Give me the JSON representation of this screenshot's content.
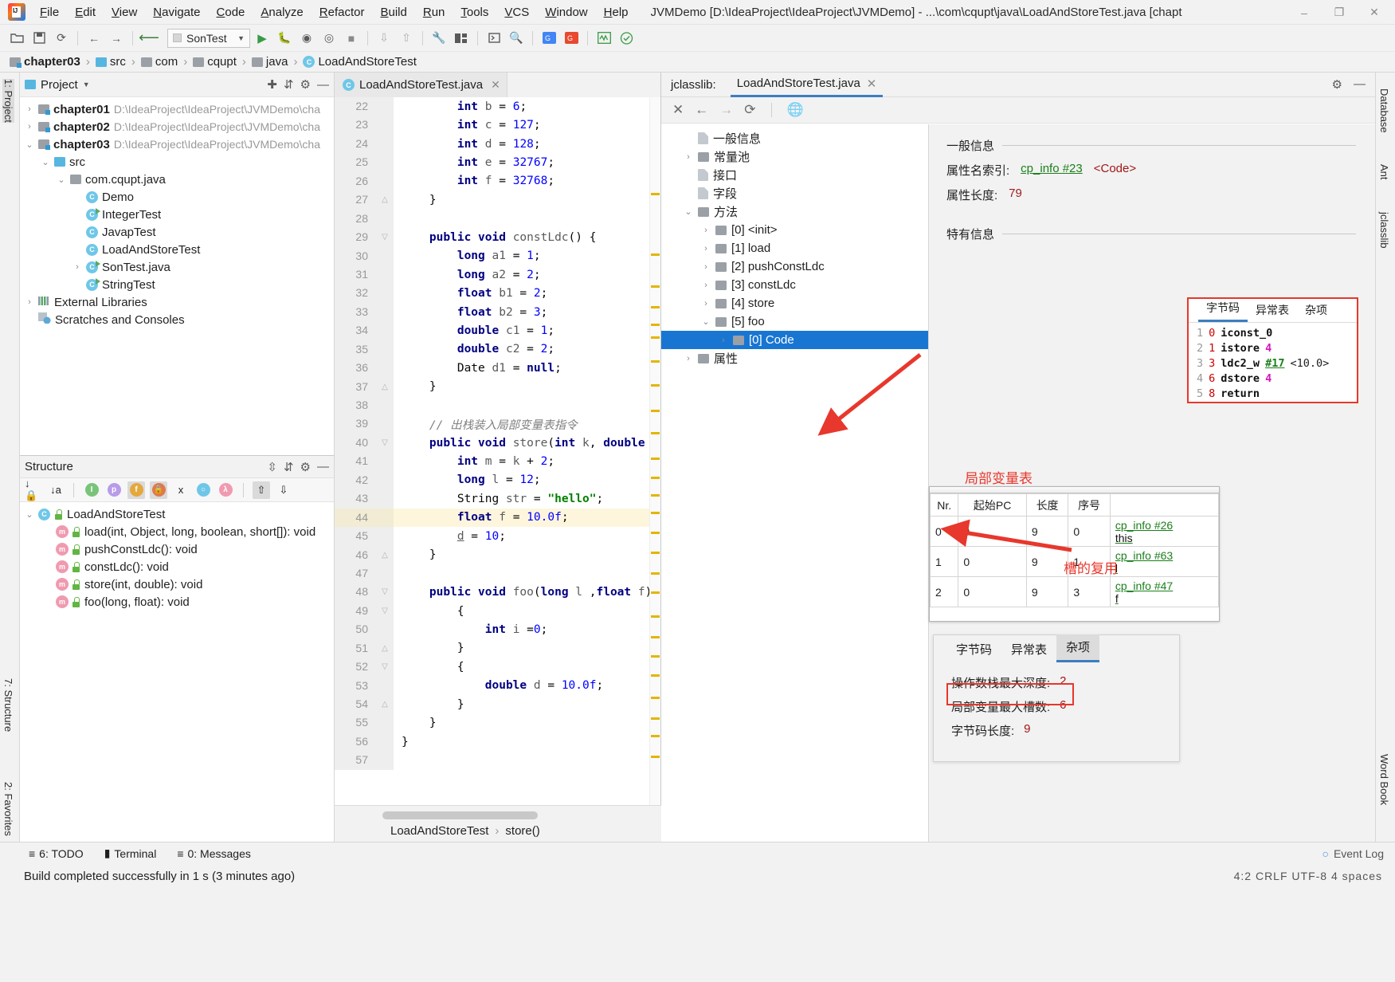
{
  "window": {
    "title": "JVMDemo [D:\\IdeaProject\\IdeaProject\\JVMDemo] - ...\\com\\cqupt\\java\\LoadAndStoreTest.java [chapt",
    "minimize": "–",
    "maximize": "❐",
    "close": "✕"
  },
  "menu": [
    "File",
    "Edit",
    "View",
    "Navigate",
    "Code",
    "Analyze",
    "Refactor",
    "Build",
    "Run",
    "Tools",
    "VCS",
    "Window",
    "Help"
  ],
  "toolbar": {
    "run_config": "SonTest"
  },
  "breadcrumb": [
    "chapter03",
    "src",
    "com",
    "cqupt",
    "java",
    "LoadAndStoreTest"
  ],
  "rails": {
    "left": [
      "1: Project",
      "7: Structure",
      "2: Favorites"
    ],
    "right": [
      "Database",
      "Ant",
      "jclasslib",
      "Word Book"
    ]
  },
  "project": {
    "title": "Project",
    "tree": [
      {
        "indent": 0,
        "arrow": "›",
        "icon": "module",
        "label": "chapter01",
        "path": "D:\\IdeaProject\\IdeaProject\\JVMDemo\\cha",
        "bold": true
      },
      {
        "indent": 0,
        "arrow": "›",
        "icon": "module",
        "label": "chapter02",
        "path": "D:\\IdeaProject\\IdeaProject\\JVMDemo\\cha",
        "bold": true
      },
      {
        "indent": 0,
        "arrow": "⌄",
        "icon": "module",
        "label": "chapter03",
        "path": "D:\\IdeaProject\\IdeaProject\\JVMDemo\\cha",
        "bold": true
      },
      {
        "indent": 1,
        "arrow": "⌄",
        "icon": "srcfolder",
        "label": "src",
        "path": "",
        "bold": false
      },
      {
        "indent": 2,
        "arrow": "⌄",
        "icon": "package",
        "label": "com.cqupt.java",
        "path": "",
        "bold": false
      },
      {
        "indent": 3,
        "arrow": "",
        "icon": "class",
        "label": "Demo",
        "path": "",
        "bold": false
      },
      {
        "indent": 3,
        "arrow": "",
        "icon": "class-run",
        "label": "IntegerTest",
        "path": "",
        "bold": false
      },
      {
        "indent": 3,
        "arrow": "",
        "icon": "class",
        "label": "JavapTest",
        "path": "",
        "bold": false
      },
      {
        "indent": 3,
        "arrow": "",
        "icon": "class",
        "label": "LoadAndStoreTest",
        "path": "",
        "bold": false
      },
      {
        "indent": 3,
        "arrow": "›",
        "icon": "class-run",
        "label": "SonTest.java",
        "path": "",
        "bold": false
      },
      {
        "indent": 3,
        "arrow": "",
        "icon": "class-run",
        "label": "StringTest",
        "path": "",
        "bold": false
      },
      {
        "indent": 0,
        "arrow": "›",
        "icon": "libs",
        "label": "External Libraries",
        "path": "",
        "bold": false
      },
      {
        "indent": 0,
        "arrow": "",
        "icon": "scratch",
        "label": "Scratches and Consoles",
        "path": "",
        "bold": false
      }
    ]
  },
  "structure": {
    "title": "Structure",
    "items": [
      {
        "indent": 0,
        "arrow": "⌄",
        "icon": "class",
        "label": "LoadAndStoreTest"
      },
      {
        "indent": 1,
        "arrow": "",
        "icon": "method",
        "label": "load(int, Object, long, boolean, short[]): void"
      },
      {
        "indent": 1,
        "arrow": "",
        "icon": "method",
        "label": "pushConstLdc(): void"
      },
      {
        "indent": 1,
        "arrow": "",
        "icon": "method",
        "label": "constLdc(): void"
      },
      {
        "indent": 1,
        "arrow": "",
        "icon": "method",
        "label": "store(int, double): void"
      },
      {
        "indent": 1,
        "arrow": "",
        "icon": "method",
        "label": "foo(long, float): void"
      }
    ]
  },
  "editor": {
    "tab": "LoadAndStoreTest.java",
    "crumb": [
      "LoadAndStoreTest",
      "store()"
    ],
    "first_line": 22,
    "highlight_line": 44,
    "lines": [
      {
        "n": 22,
        "fold": "",
        "html": "        <span class='kw'>int</span> <span class='id'>b</span> = <span class='num'>6</span>;",
        "clip": true
      },
      {
        "n": 23,
        "fold": "",
        "html": "        <span class='kw'>int</span> <span class='id'>c</span> = <span class='num'>127</span>;"
      },
      {
        "n": 24,
        "fold": "",
        "html": "        <span class='kw'>int</span> <span class='id'>d</span> = <span class='num'>128</span>;"
      },
      {
        "n": 25,
        "fold": "",
        "html": "        <span class='kw'>int</span> <span class='id'>e</span> = <span class='num'>32767</span>;"
      },
      {
        "n": 26,
        "fold": "",
        "html": "        <span class='kw'>int</span> <span class='id'>f</span> = <span class='num'>32768</span>;"
      },
      {
        "n": 27,
        "fold": "end",
        "html": "    }"
      },
      {
        "n": 28,
        "fold": "",
        "html": ""
      },
      {
        "n": 29,
        "fold": "start",
        "html": "    <span class='kw'>public void</span> <span class='id'>constLdc</span>() {"
      },
      {
        "n": 30,
        "fold": "",
        "html": "        <span class='kw'>long</span> <span class='id'>a1</span> = <span class='num'>1</span>;"
      },
      {
        "n": 31,
        "fold": "",
        "html": "        <span class='kw'>long</span> <span class='id'>a2</span> = <span class='num'>2</span>;"
      },
      {
        "n": 32,
        "fold": "",
        "html": "        <span class='kw'>float</span> <span class='id'>b1</span> = <span class='num'>2</span>;"
      },
      {
        "n": 33,
        "fold": "",
        "html": "        <span class='kw'>float</span> <span class='id'>b2</span> = <span class='num'>3</span>;"
      },
      {
        "n": 34,
        "fold": "",
        "html": "        <span class='kw'>double</span> <span class='id'>c1</span> = <span class='num'>1</span>;"
      },
      {
        "n": 35,
        "fold": "",
        "html": "        <span class='kw'>double</span> <span class='id'>c2</span> = <span class='num'>2</span>;"
      },
      {
        "n": 36,
        "fold": "",
        "html": "        Date <span class='id'>d1</span> = <span class='kw'>null</span>;"
      },
      {
        "n": 37,
        "fold": "end",
        "html": "    }"
      },
      {
        "n": 38,
        "fold": "",
        "html": ""
      },
      {
        "n": 39,
        "fold": "",
        "html": "    <span class='cmt'>// 出栈装入局部变量表指令</span>"
      },
      {
        "n": 40,
        "fold": "start",
        "html": "    <span class='kw'>public void</span> <span class='id'>store</span>(<span class='kw'>int</span> <span class='id'>k</span>, <span class='kw'>double</span> <span class='id und'>d</span>) {"
      },
      {
        "n": 41,
        "fold": "",
        "html": "        <span class='kw'>int</span> <span class='id'>m</span> = <span class='id'>k</span> + <span class='num'>2</span>;"
      },
      {
        "n": 42,
        "fold": "",
        "html": "        <span class='kw'>long</span> <span class='id'>l</span> = <span class='num'>12</span>;"
      },
      {
        "n": 43,
        "fold": "",
        "html": "        String <span class='id'>str</span> = <span class='str'>\"hello\"</span>;"
      },
      {
        "n": 44,
        "fold": "",
        "html": "        <span class='kw'>float</span> <span class='id'>f</span> = <span class='num'>10.0f</span>;"
      },
      {
        "n": 45,
        "fold": "",
        "html": "        <span class='id und'>d</span> = <span class='num'>10</span>;"
      },
      {
        "n": 46,
        "fold": "end",
        "html": "    }"
      },
      {
        "n": 47,
        "fold": "",
        "html": ""
      },
      {
        "n": 48,
        "fold": "start",
        "html": "    <span class='kw'>public void</span> <span class='id'>foo</span>(<span class='kw'>long</span> <span class='id'>l</span> ,<span class='kw'>float</span> <span class='id'>f</span>) {"
      },
      {
        "n": 49,
        "fold": "start",
        "html": "        {"
      },
      {
        "n": 50,
        "fold": "",
        "html": "            <span class='kw'>int</span> <span class='id'>i</span> =<span class='num'>0</span>;"
      },
      {
        "n": 51,
        "fold": "end",
        "html": "        }"
      },
      {
        "n": 52,
        "fold": "start",
        "html": "        {"
      },
      {
        "n": 53,
        "fold": "",
        "html": "            <span class='kw'>double</span> <span class='id'>d</span> = <span class='num'>10.0f</span>;"
      },
      {
        "n": 54,
        "fold": "end",
        "html": "        }"
      },
      {
        "n": 55,
        "fold": "",
        "html": "    }"
      },
      {
        "n": 56,
        "fold": "",
        "html": "}"
      },
      {
        "n": 57,
        "fold": "",
        "html": ""
      }
    ]
  },
  "jclasslib": {
    "prefix": "jclasslib:",
    "tab": "LoadAndStoreTest.java",
    "toolbar": [
      "close-icon",
      "back-icon",
      "forward-icon",
      "reload-icon",
      "browser-icon"
    ],
    "tree": [
      {
        "indent": 1,
        "arrow": "",
        "icon": "file",
        "label": "一般信息",
        "sel": false
      },
      {
        "indent": 1,
        "arrow": "›",
        "icon": "folder",
        "label": "常量池",
        "sel": false
      },
      {
        "indent": 1,
        "arrow": "",
        "icon": "file",
        "label": "接口",
        "sel": false
      },
      {
        "indent": 1,
        "arrow": "",
        "icon": "file",
        "label": "字段",
        "sel": false
      },
      {
        "indent": 1,
        "arrow": "⌄",
        "icon": "folder",
        "label": "方法",
        "sel": false
      },
      {
        "indent": 2,
        "arrow": "›",
        "icon": "folder",
        "label": "[0] <init>",
        "sel": false
      },
      {
        "indent": 2,
        "arrow": "›",
        "icon": "folder",
        "label": "[1] load",
        "sel": false
      },
      {
        "indent": 2,
        "arrow": "›",
        "icon": "folder",
        "label": "[2] pushConstLdc",
        "sel": false
      },
      {
        "indent": 2,
        "arrow": "›",
        "icon": "folder",
        "label": "[3] constLdc",
        "sel": false
      },
      {
        "indent": 2,
        "arrow": "›",
        "icon": "folder",
        "label": "[4] store",
        "sel": false
      },
      {
        "indent": 2,
        "arrow": "⌄",
        "icon": "folder",
        "label": "[5] foo",
        "sel": false
      },
      {
        "indent": 3,
        "arrow": "›",
        "icon": "folder",
        "label": "[0] Code",
        "sel": true
      },
      {
        "indent": 1,
        "arrow": "›",
        "icon": "folder",
        "label": "属性",
        "sel": false
      }
    ],
    "detail": {
      "general_section": "一般信息",
      "attr_name_key": "属性名索引:",
      "attr_name_value": "cp_info #23",
      "attr_name_note": "<Code>",
      "attr_len_key": "属性长度:",
      "attr_len_value": "79",
      "specific_section": "特有信息"
    },
    "bytecode_box": {
      "tabs": [
        "字节码",
        "异常表",
        "杂项"
      ],
      "selected_tab": "字节码",
      "lines": [
        {
          "n": "1",
          "offset": "0",
          "op": "iconst_0",
          "arg": "",
          "cp": "",
          "note": ""
        },
        {
          "n": "2",
          "offset": "1",
          "op": "istore",
          "arg": "4",
          "cp": "",
          "note": ""
        },
        {
          "n": "3",
          "offset": "3",
          "op": "ldc2_w",
          "arg": "",
          "cp": "#17",
          "note": "<10.0>"
        },
        {
          "n": "4",
          "offset": "6",
          "op": "dstore",
          "arg": "4",
          "cp": "",
          "note": ""
        },
        {
          "n": "5",
          "offset": "8",
          "op": "return",
          "arg": "",
          "cp": "",
          "note": ""
        }
      ]
    },
    "local_var_table": {
      "label": "局部变量表",
      "columns": [
        "Nr.",
        "起始PC",
        "长度",
        "序号",
        ""
      ],
      "rows": [
        {
          "nr": "0",
          "start_pc": "0",
          "length": "9",
          "index": "0",
          "cp": "cp_info #26",
          "name": "this"
        },
        {
          "nr": "1",
          "start_pc": "0",
          "length": "9",
          "index": "1",
          "cp": "cp_info #63",
          "name": "l"
        },
        {
          "nr": "2",
          "start_pc": "0",
          "length": "9",
          "index": "3",
          "cp": "cp_info #47",
          "name": "f"
        }
      ]
    },
    "misc": {
      "tabs": [
        "字节码",
        "异常表",
        "杂项"
      ],
      "selected_tab": "杂项",
      "rows": [
        {
          "key": "操作数栈最大深度:",
          "value": "2"
        },
        {
          "key": "局部变量最大槽数:",
          "value": "6"
        },
        {
          "key": "字节码长度:",
          "value": "9"
        }
      ]
    }
  },
  "annotations": [
    {
      "text": "槽的复用"
    }
  ],
  "bottom_bar": [
    {
      "label": "6: TODO",
      "icon": "list-icon"
    },
    {
      "label": "Terminal",
      "icon": "terminal-icon"
    },
    {
      "label": "0: Messages",
      "icon": "messages-icon"
    }
  ],
  "bottom_right": "Event Log",
  "status": {
    "text": "Build completed successfully in 1 s (3 minutes ago)",
    "right": "4:2   CRLF  UTF-8  4 spaces"
  },
  "colors": {
    "accent": "#3d7ec0",
    "selection": "#1876d2",
    "annotation": "#e8372c",
    "keyword": "#000080",
    "string": "#008000",
    "number": "#0000ff"
  }
}
